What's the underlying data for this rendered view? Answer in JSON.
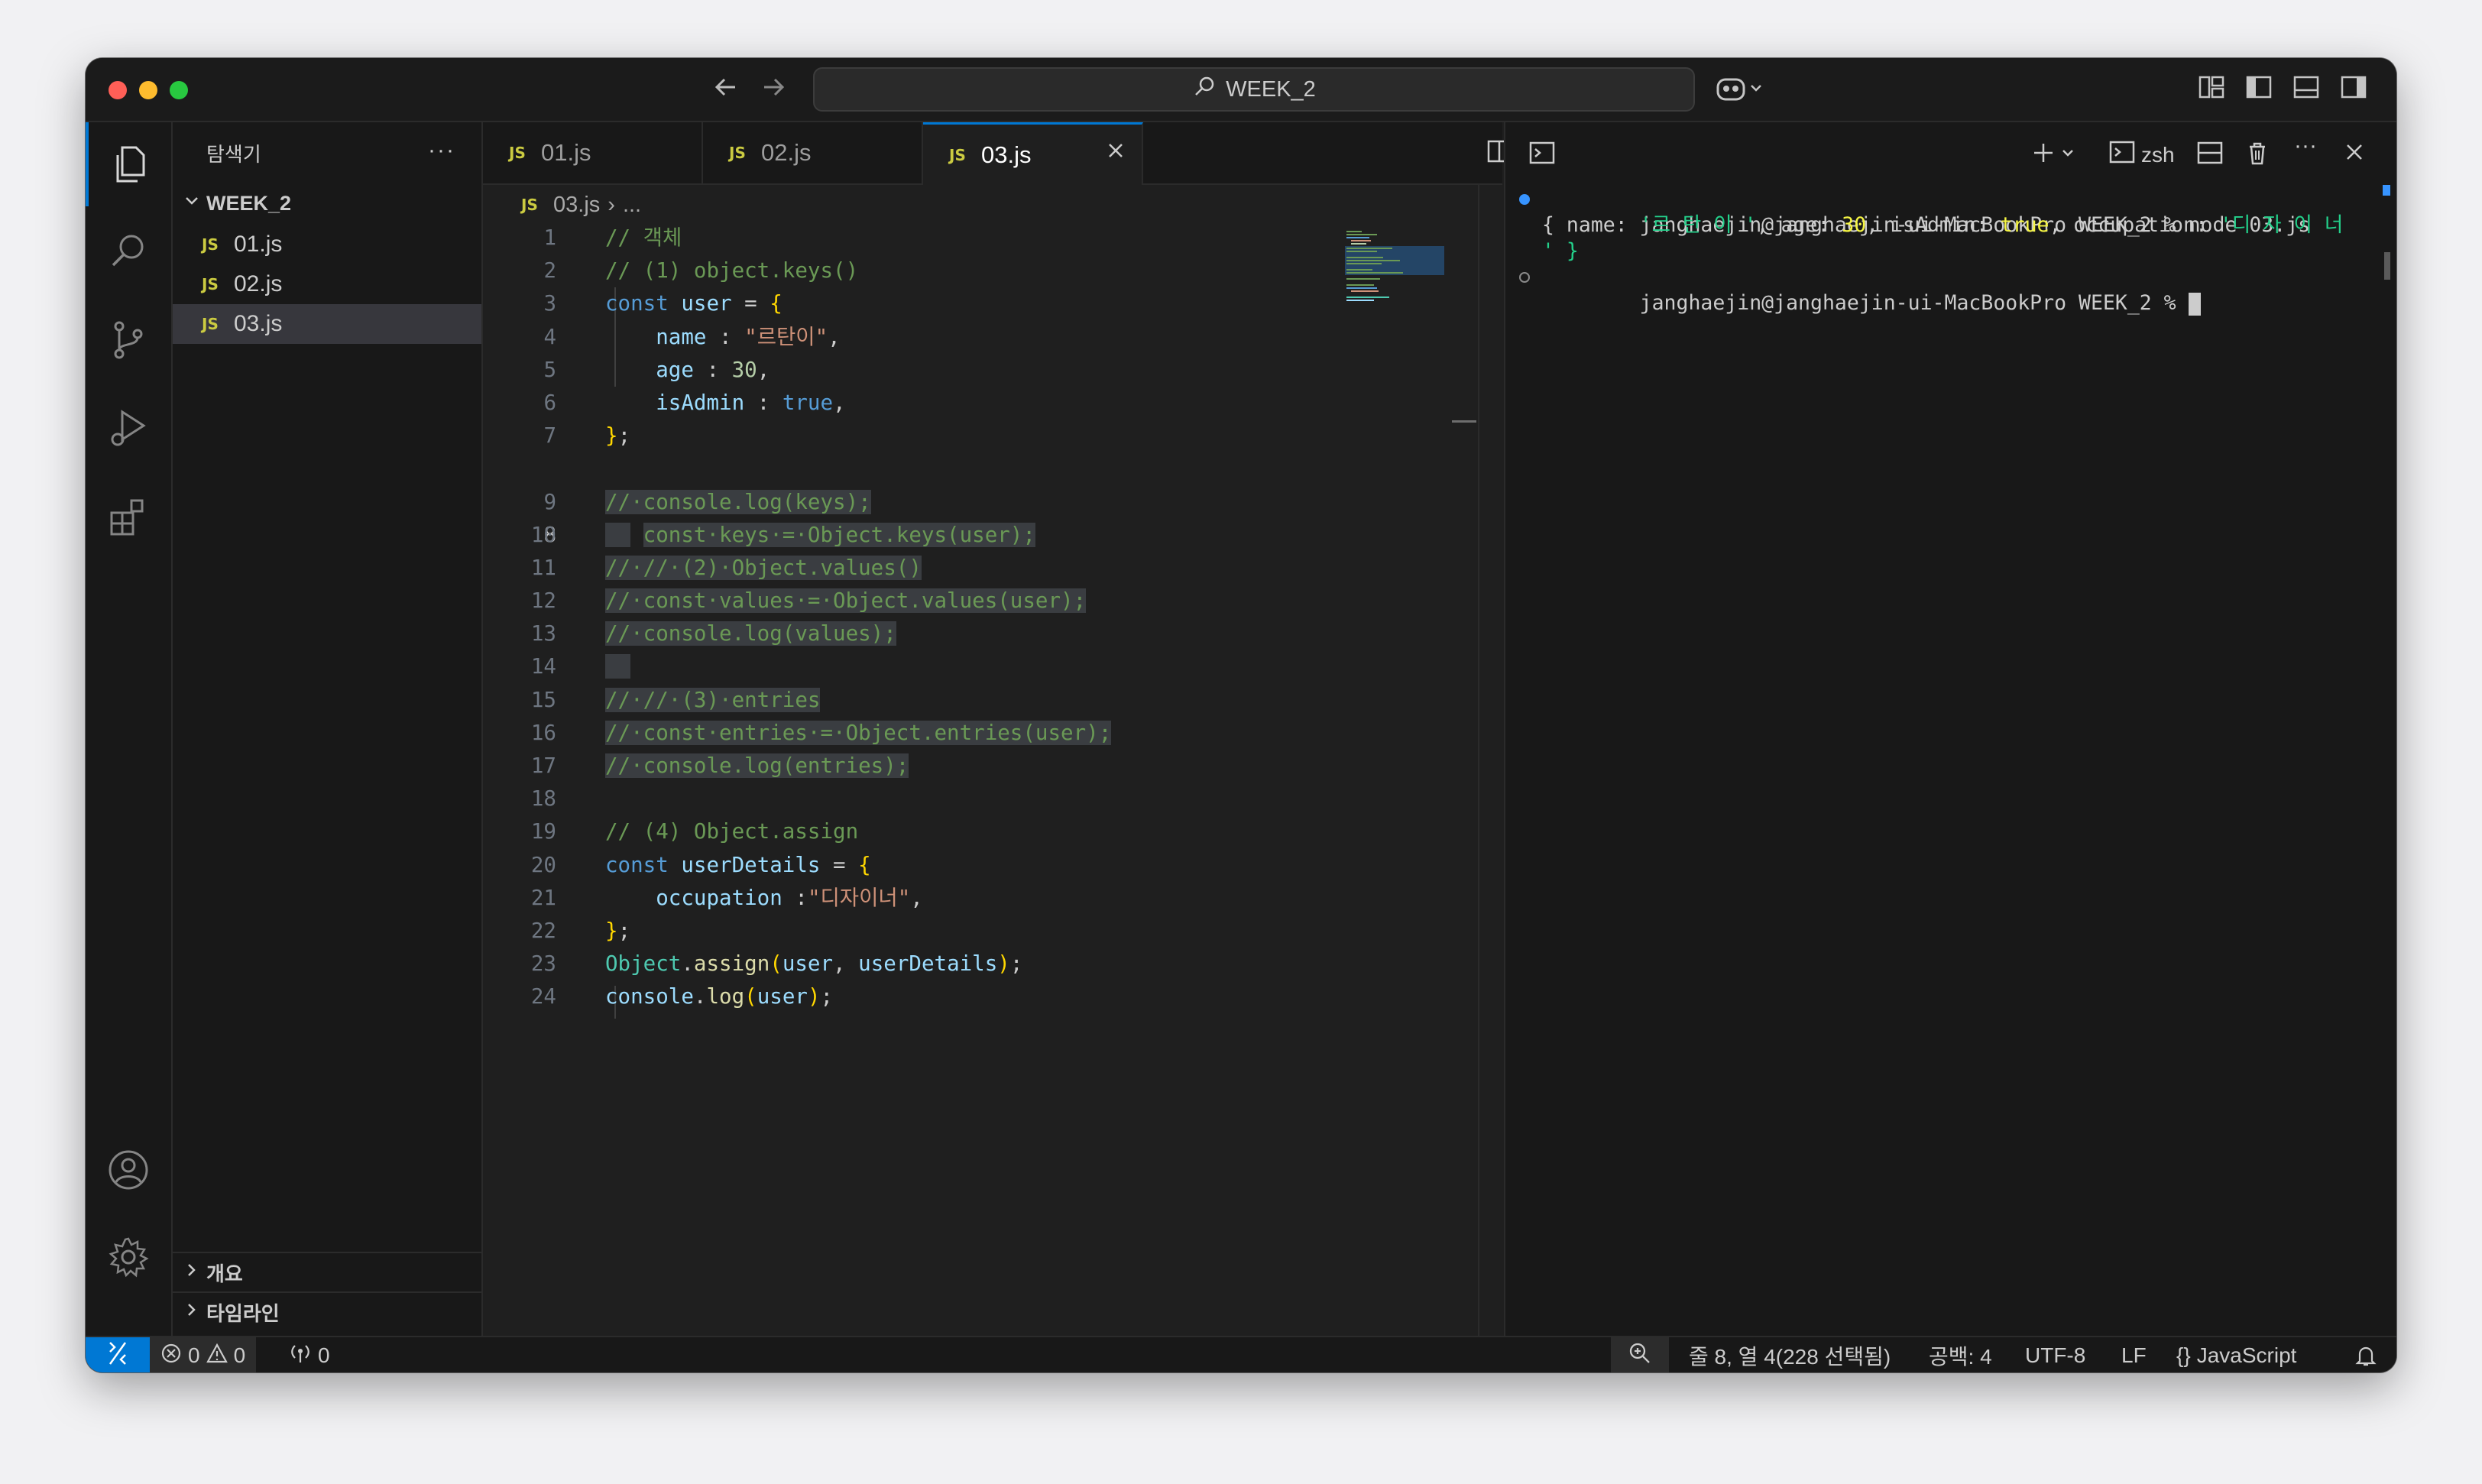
{
  "titlebar": {
    "search_text": "WEEK_2"
  },
  "sidebar": {
    "title": "탐색기",
    "folder": "WEEK_2",
    "files": [
      {
        "badge": "JS",
        "name": "01.js"
      },
      {
        "badge": "JS",
        "name": "02.js"
      },
      {
        "badge": "JS",
        "name": "03.js"
      }
    ],
    "sections": [
      "개요",
      "타임라인"
    ]
  },
  "editor": {
    "tabs": [
      {
        "badge": "JS",
        "name": "01.js"
      },
      {
        "badge": "JS",
        "name": "02.js"
      },
      {
        "badge": "JS",
        "name": "03.js"
      }
    ],
    "breadcrumb": {
      "badge": "JS",
      "file": "03.js",
      "sep": "›",
      "rest": "..."
    },
    "line_numbers": [
      "1",
      "2",
      "3",
      "4",
      "5",
      "6",
      "7",
      "8",
      "9",
      "10",
      "11",
      "12",
      "13",
      "14",
      "15",
      "16",
      "17",
      "18",
      "19",
      "20",
      "21",
      "22",
      "23",
      "24"
    ],
    "current_line": 8
  },
  "terminal": {
    "shell": "zsh",
    "prompt1": "janghaejin@janghaejin-ui-MacBookPro WEEK_2 % node 03.js",
    "output1_a": "{ name: ",
    "output1_name": "'르 탄 이 '",
    "output1_b": ", age: ",
    "output1_age": "30",
    "output1_c": ", isAdmin: ",
    "output1_admin": "true",
    "output1_d": ", occupation: ",
    "output1_occ": "'디 자 이 너",
    "output2_a": "' }",
    "prompt2": "janghaejin@janghaejin-ui-MacBookPro WEEK_2 % "
  },
  "statusbar": {
    "errors": "0",
    "warnings": "0",
    "ports": "0",
    "position": "줄 8, 열 4(228 선택됨)",
    "spaces": "공백: 4",
    "encoding": "UTF-8",
    "eol": "LF",
    "language_braces": "{}",
    "language": "JavaScript"
  },
  "colors": {
    "accent": "#0078d4",
    "js_badge": "#cbcb41",
    "comment": "#6a9955",
    "keyword": "#569cd6",
    "string": "#ce9178"
  }
}
